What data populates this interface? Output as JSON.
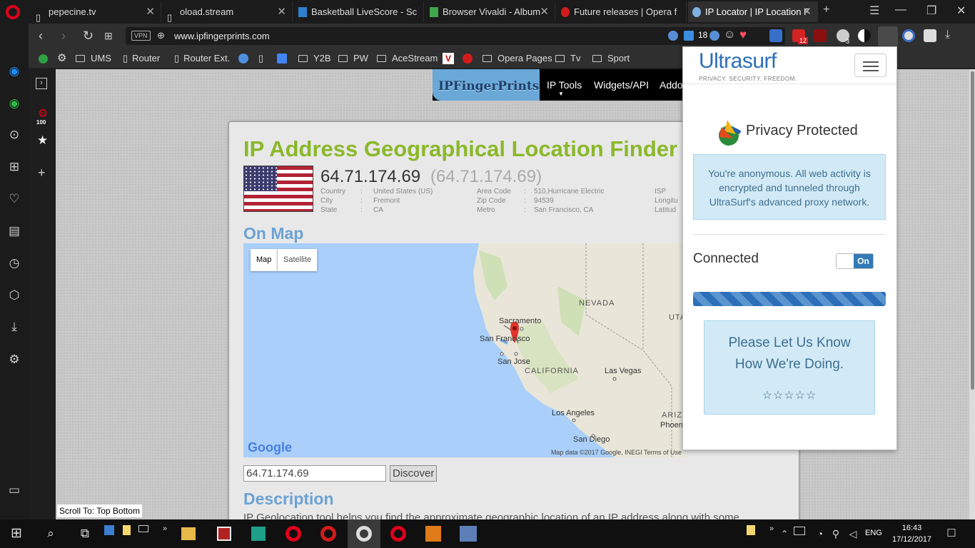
{
  "tabs": [
    {
      "title": "pepecine.tv"
    },
    {
      "title": "oload.stream"
    },
    {
      "title": "Basketball LiveScore - Sc"
    },
    {
      "title": "Browser Vivaldi - Album"
    },
    {
      "title": "Future releases | Opera f"
    },
    {
      "title": "IP Locator | IP Location F"
    }
  ],
  "address_bar": {
    "vpn_label": "VPN",
    "url": "www.ipfingerprints.com",
    "badge_count": "18"
  },
  "extensions": {
    "mail_badge": "12",
    "s_badge": "3"
  },
  "bookmarks": [
    "UMS",
    "Router",
    "Router Ext.",
    "Y2B",
    "PW",
    "AceStream",
    "Opera Pages",
    "Tv",
    "Sport"
  ],
  "sidebar": {
    "badge": "100"
  },
  "site": {
    "logo": "IPFingerPrints",
    "nav": [
      "IP Tools",
      "Widgets/API",
      "Addon"
    ],
    "title": "IP Address Geographical Location Finder",
    "ip": "64.71.174.69",
    "ip_secondary": "(64.71.174.69)",
    "info": {
      "country_label": "Country",
      "country": "United States (US)",
      "city_label": "City",
      "city": "Fremont",
      "state_label": "State",
      "state": "CA",
      "areacode_label": "Area Code",
      "areacode": "510,Hurricane Electric",
      "zip_label": "Zip Code",
      "zip": "94539",
      "metro_label": "Metro",
      "metro": "San Francisco, CA",
      "isp_label": "ISP",
      "longitude_label": "Longitu",
      "latitude_label": "Latitud",
      "sep": ":"
    },
    "map_heading": "On Map",
    "map_tabs": [
      "Map",
      "Satellite"
    ],
    "map_labels": {
      "sacramento": "Sacramento",
      "san_francisco": "San Francisco",
      "san_jose": "San Jose",
      "california": "CALIFORNIA",
      "nevada": "NEVADA",
      "utah": "UTA",
      "las_vegas": "Las Vegas",
      "los_angeles": "Los Angeles",
      "san_diego": "San Diego",
      "arizona": "ARIZ",
      "phoenix": "Phoen"
    },
    "google_logo": "Google",
    "map_attribution": "Map data ©2017 Google, INEGI    Terms of Use",
    "ip_input_value": "64.71.174.69",
    "discover_label": "Discover",
    "description_heading": "Description",
    "description_text": "IP Geolocation tool helps you find the approximate geographic location of an IP address along with some",
    "scroll_to": "Scroll To: Top Bottom"
  },
  "ultrasurf": {
    "logo": "Ultrasurf",
    "tagline": "PRIVACY. SECURITY. FREEDOM.",
    "status": "Privacy Protected",
    "info": "You're anonymous. All web activity is encrypted and tunneled through UltraSurf's advanced proxy network.",
    "connected_label": "Connected",
    "toggle_label": "On",
    "feedback_line1": "Please Let Us Know",
    "feedback_line2": "How We're Doing.",
    "stars": "☆☆☆☆☆"
  },
  "taskbar": {
    "language": "ENG",
    "time": "16:43",
    "date": "17/12/2017"
  },
  "colors": {
    "opera_red": "#e0001b",
    "title_green": "#8bb82a",
    "heading_blue": "#6ca2d4",
    "ultrasurf_blue": "#2c6fb8"
  }
}
